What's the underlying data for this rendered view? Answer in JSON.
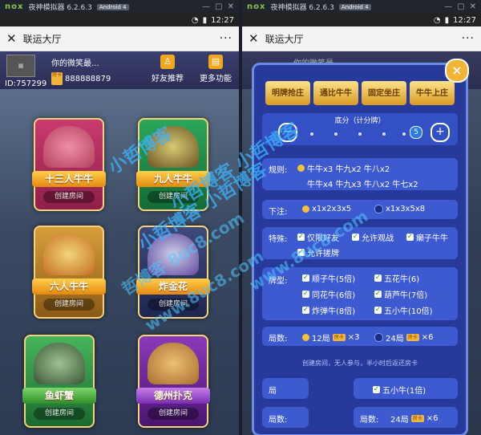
{
  "emulator": {
    "name": "nox",
    "title": "夜神模拟器 6.2.6.3",
    "android": "Android 4"
  },
  "status": {
    "time": "12:27"
  },
  "titlebar": {
    "title": "联运大厅",
    "more": "···",
    "close": "✕"
  },
  "profile": {
    "name": "你的微笑最...",
    "id": "ID:757299",
    "card_label": "房卡",
    "cards": "888888879"
  },
  "header_buttons": [
    {
      "label": "好友推荐",
      "icon": "person-add-icon"
    },
    {
      "label": "更多功能",
      "icon": "more-functions-icon"
    }
  ],
  "games": [
    {
      "name": "十三人牛牛",
      "create": "创建房间"
    },
    {
      "name": "九人牛牛",
      "create": "创建房间"
    },
    {
      "name": "六人牛牛",
      "create": "创建房间"
    },
    {
      "name": "炸金花",
      "create": "创建房间"
    },
    {
      "name": "鱼虾蟹",
      "create": "创建房间"
    },
    {
      "name": "德州扑克",
      "create": "创建房间"
    }
  ],
  "dialog": {
    "tabs": [
      "明牌抢庄",
      "通比牛牛",
      "固定坐庄",
      "牛牛上庄"
    ],
    "close": "×",
    "base": {
      "label": "底分（计分牌）",
      "value": "5",
      "minus": "−",
      "plus": "+"
    },
    "rules": {
      "label": "规则:",
      "line1": "牛牛x3 牛九x2 牛八x2",
      "line2": "牛牛x4 牛九x3 牛八x2 牛七x2"
    },
    "bet": {
      "label": "下注:",
      "options": [
        "x1x2x3x5",
        "x1x3x5x8"
      ]
    },
    "special": {
      "label": "特殊:",
      "options": [
        "仅限好友",
        "允许观战",
        "癞子牛牛",
        "允许搓牌"
      ]
    },
    "card_types": {
      "label": "牌型:",
      "options": [
        "顺子牛(5倍)",
        "五花牛(6)",
        "同花牛(6倍)",
        "葫芦牛(7倍)",
        "炸弹牛(8倍)",
        "五小牛(10倍)"
      ]
    },
    "rounds": {
      "label": "局数:",
      "options": [
        "12局",
        "24局"
      ],
      "costs": [
        "×3",
        "×6"
      ],
      "card_tag": "房卡"
    },
    "notice": "创建房间，无人参与，半小时后返还房卡",
    "bottom": {
      "left_label": "局",
      "five_small": "五小牛(1倍)",
      "rounds_label": "局数:",
      "rounds_value": "24局",
      "cost": "×6",
      "card_tag": "房卡"
    }
  },
  "watermarks": [
    "小哲博客",
    "小哲博客 小哲博客",
    "小哲博客 小哲博客",
    "哲博客 8uc8.com",
    "www.8uc8.com",
    "www.8uc8.com"
  ]
}
